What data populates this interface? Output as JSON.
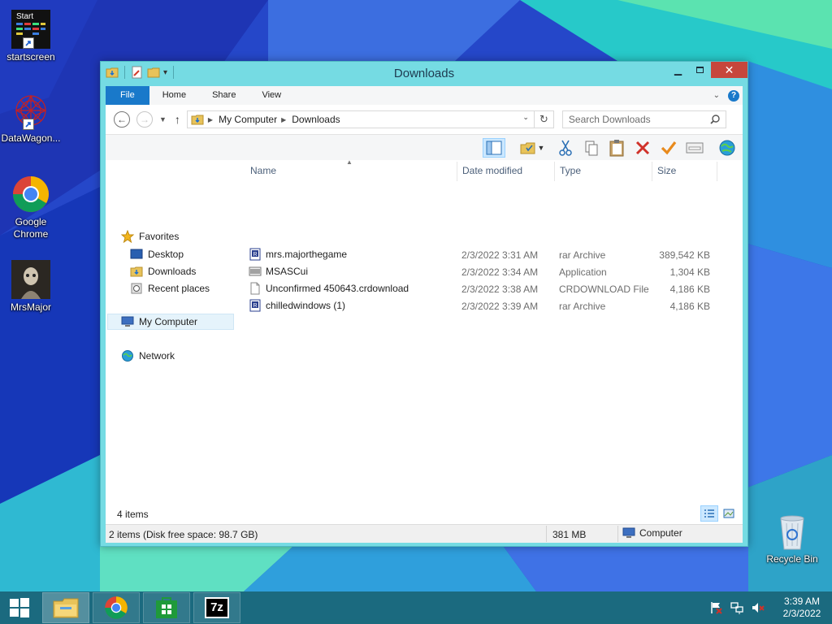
{
  "desktop": {
    "icons": [
      {
        "label": "startscreen",
        "badge": "Start"
      },
      {
        "label": "DataWagon..."
      },
      {
        "label": "Google Chrome"
      },
      {
        "label": "MrsMajor"
      },
      {
        "label": "Recycle Bin"
      }
    ]
  },
  "window": {
    "title": "Downloads",
    "ribbon_tabs": [
      "File",
      "Home",
      "Share",
      "View"
    ],
    "address": {
      "crumbs": [
        "My Computer",
        "Downloads"
      ]
    },
    "search": {
      "placeholder": "Search Downloads"
    },
    "nav": {
      "favorites": "Favorites",
      "favorite_items": [
        "Desktop",
        "Downloads",
        "Recent places"
      ],
      "my_computer": "My Computer",
      "network": "Network"
    },
    "columns": [
      "Name",
      "Date modified",
      "Type",
      "Size"
    ],
    "files": [
      {
        "name": "mrs.majorthegame",
        "date": "2/3/2022 3:31 AM",
        "type": "rar Archive",
        "size": "389,542 KB",
        "icon": "rar-archive-icon"
      },
      {
        "name": "MSASCui",
        "date": "2/3/2022 3:34 AM",
        "type": "Application",
        "size": "1,304 KB",
        "icon": "application-icon"
      },
      {
        "name": "Unconfirmed 450643.crdownload",
        "date": "2/3/2022 3:38 AM",
        "type": "CRDOWNLOAD File",
        "size": "4,186 KB",
        "icon": "blank-file-icon"
      },
      {
        "name": "chilledwindows (1)",
        "date": "2/3/2022 3:39 AM",
        "type": "rar Archive",
        "size": "4,186 KB",
        "icon": "rar-archive-icon"
      }
    ],
    "items_count": "4 items",
    "status": {
      "selection": "2 items (Disk free space: 98.7 GB)",
      "size": "381 MB",
      "zone": "Computer"
    }
  },
  "taskbar": {
    "apps": [
      "file-explorer",
      "chrome",
      "store",
      "7zip"
    ],
    "seven_zip_label": "7z",
    "clock": {
      "time": "3:39 AM",
      "date": "2/3/2022"
    }
  },
  "colors": {
    "window_frame": "#75dbe3",
    "ribbon_file": "#1979ca",
    "close_button": "#c7463c"
  }
}
